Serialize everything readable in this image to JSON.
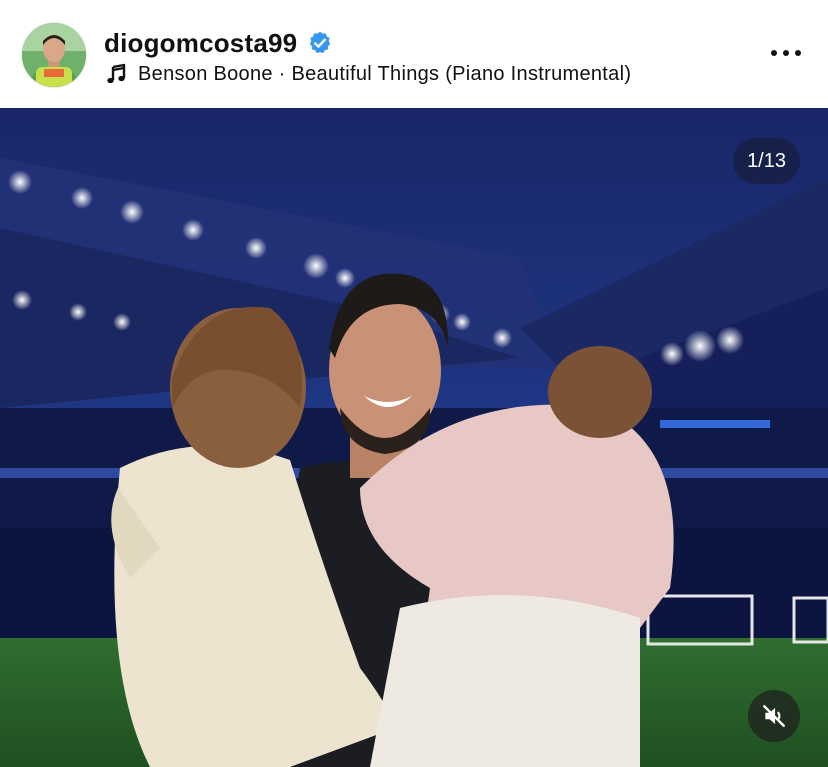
{
  "post": {
    "username": "diogomcosta99",
    "verified": true,
    "music": {
      "icon": "music-note-icon",
      "text": "Benson Boone · Beautiful Things (Piano Instrumental)"
    },
    "more_icon": "more-horizontal-icon"
  },
  "media": {
    "current_slide": 1,
    "total_slides": 13,
    "counter_text": "1/13",
    "audio_icon": "muted-speaker-icon"
  },
  "colors": {
    "verified_blue": "#3797f0",
    "text": "#111111",
    "sky": "#1b2a6e",
    "grass": "#2e6b2e"
  }
}
